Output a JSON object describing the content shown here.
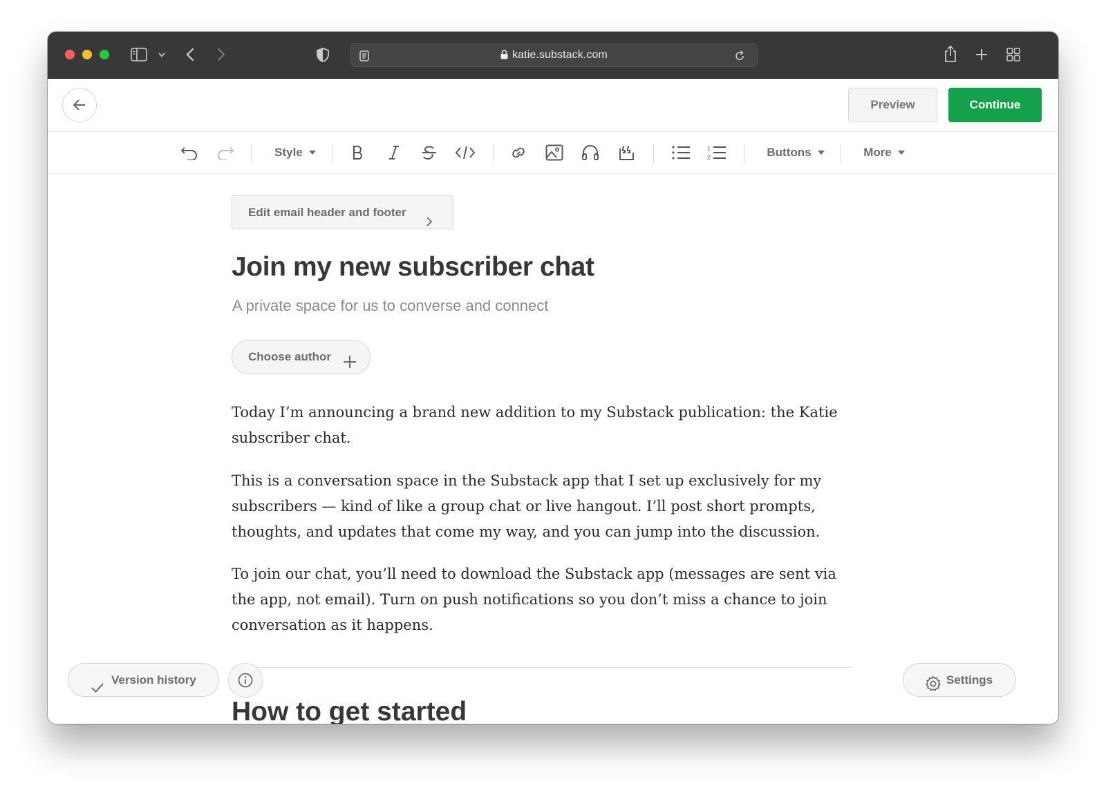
{
  "browser": {
    "url": "katie.substack.com",
    "colors": {
      "close": "#fe5f57",
      "minimize": "#febc2e",
      "maximize": "#28c840"
    }
  },
  "header": {
    "preview_label": "Preview",
    "continue_label": "Continue",
    "accent_color": "#15a04c"
  },
  "toolbar": {
    "style_label": "Style",
    "buttons_label": "Buttons",
    "more_label": "More"
  },
  "editor": {
    "edit_header_label": "Edit email header and footer",
    "title": "Join my new subscriber chat",
    "subtitle": "A private space for us to converse and connect",
    "choose_author_label": "Choose author",
    "paragraphs": [
      "Today I’m announcing a brand new addition to my Substack publication: the Katie subscriber chat.",
      "This is a conversation space in the Substack app that I set up exclusively for my subscribers — kind of like a group chat or live hangout. I’ll post short prompts, thoughts, and updates that come my way, and you can jump into the discussion.",
      "To join our chat, you’ll need to download the Substack app (messages are sent via the app, not email). Turn on push notifications so you don’t miss a chance to join conversation as it happens."
    ],
    "next_heading": "How to get started"
  },
  "footer": {
    "version_history_label": "Version history",
    "settings_label": "Settings"
  }
}
